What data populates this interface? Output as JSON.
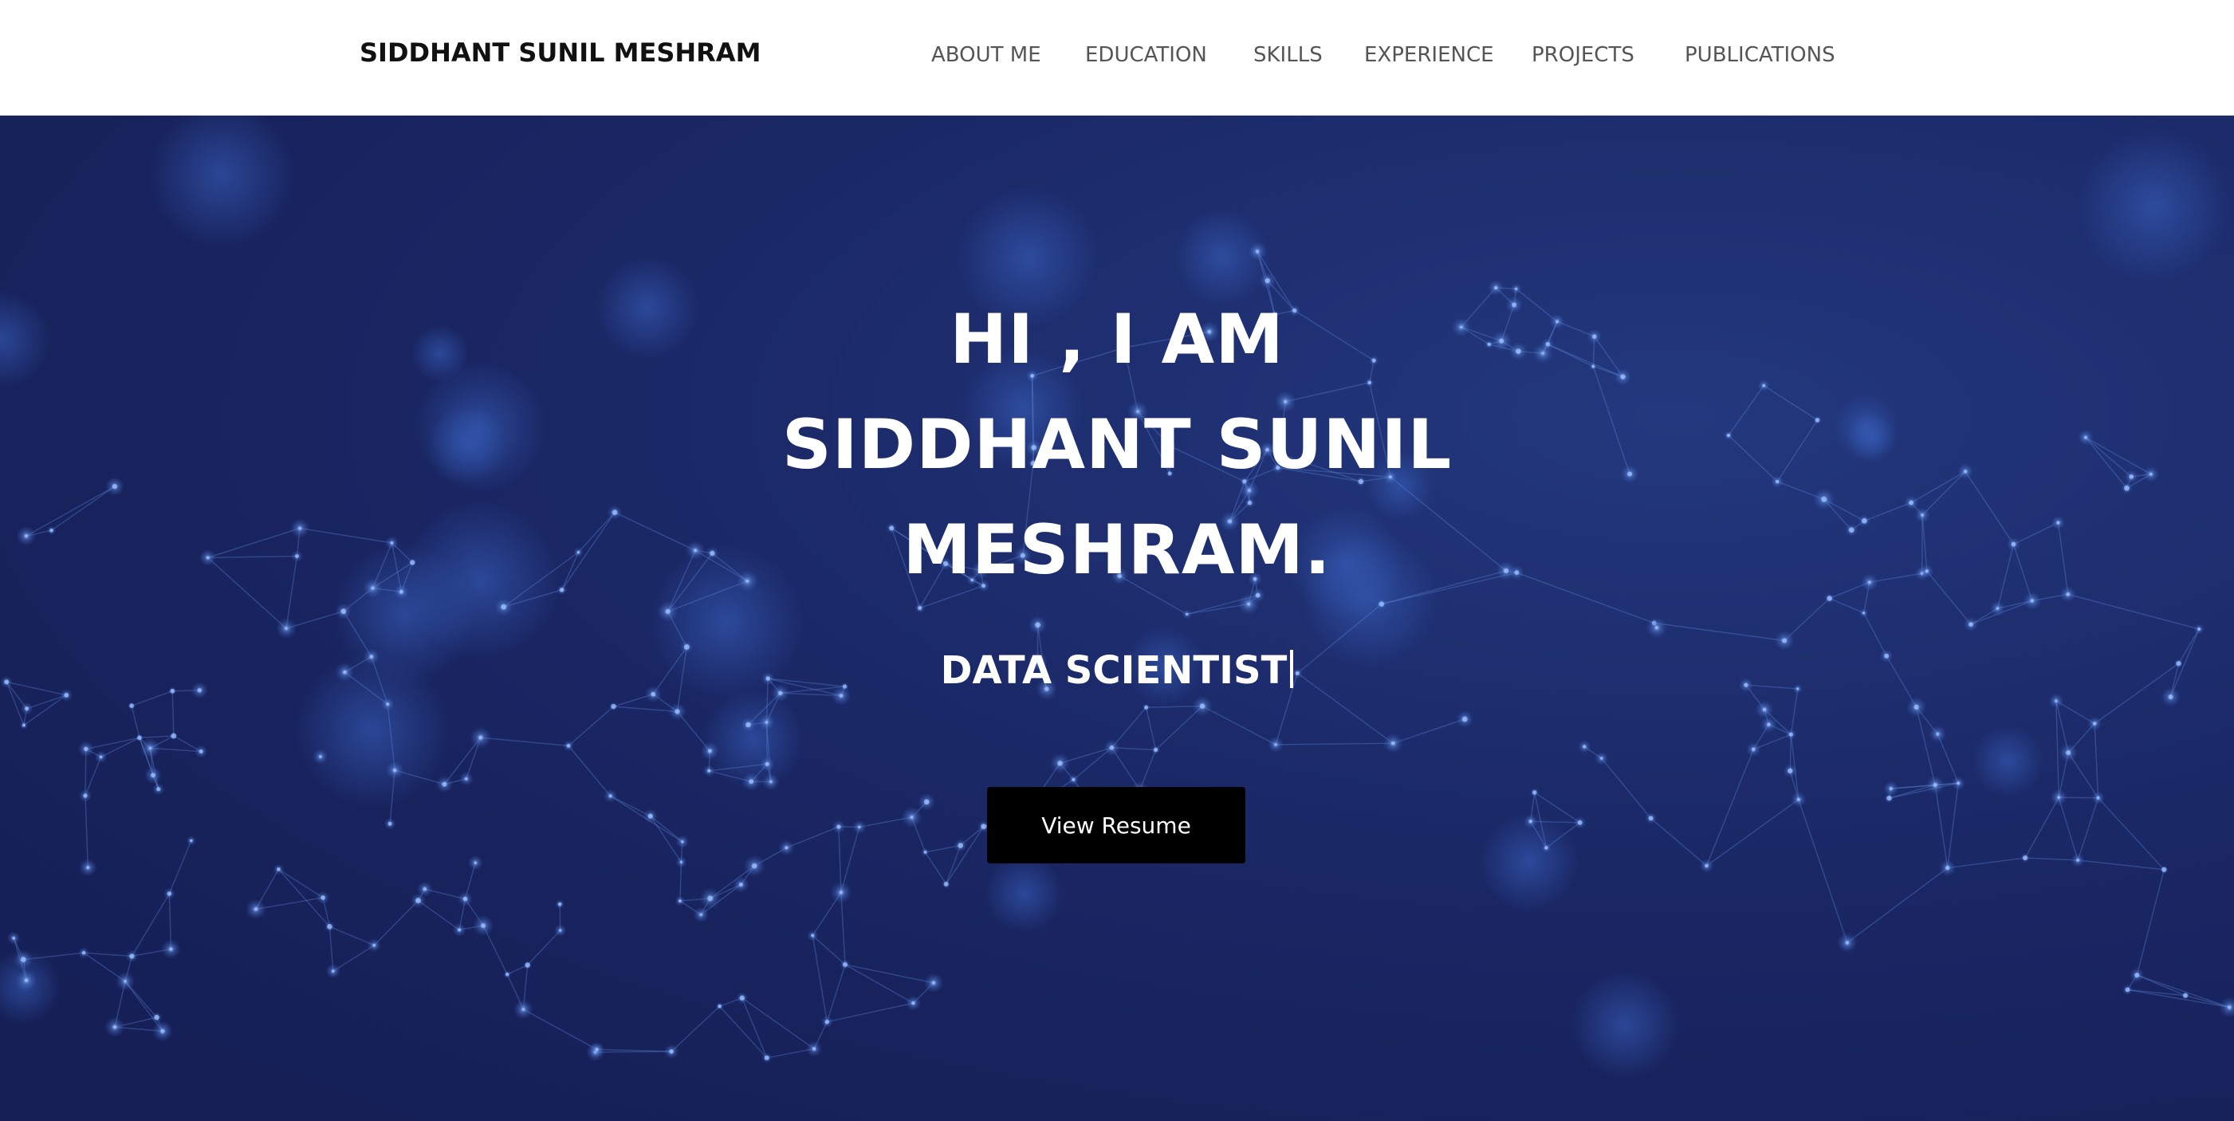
{
  "header": {
    "brand": "SIDDHANT SUNIL MESHRAM",
    "nav": [
      {
        "label": "ABOUT ME"
      },
      {
        "label": "EDUCATION"
      },
      {
        "label": "SKILLS"
      },
      {
        "label": "EXPERIENCE"
      },
      {
        "label": "PROJECTS"
      },
      {
        "label": "PUBLICATIONS"
      }
    ]
  },
  "hero": {
    "title_lines": [
      "HI , I AM",
      "SIDDHANT SUNIL",
      "MESHRAM."
    ],
    "subtitle": "DATA SCIENTIST",
    "resume_button": "View Resume"
  },
  "colors": {
    "header_bg": "#ffffff",
    "hero_bg": "#1b2968",
    "network_lines": "#5b86d6",
    "button_bg": "#000000",
    "text_light": "#ffffff"
  }
}
